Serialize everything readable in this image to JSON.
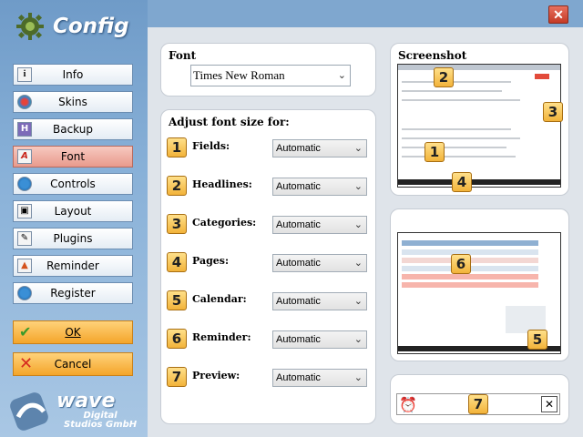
{
  "app": {
    "title": "Config"
  },
  "sidebar": {
    "items": [
      {
        "label": "Info",
        "icon": "info-icon",
        "active": false
      },
      {
        "label": "Skins",
        "icon": "skins-icon",
        "active": false
      },
      {
        "label": "Backup",
        "icon": "backup-icon",
        "active": false
      },
      {
        "label": "Font",
        "icon": "font-icon",
        "active": true
      },
      {
        "label": "Controls",
        "icon": "controls-icon",
        "active": false
      },
      {
        "label": "Layout",
        "icon": "layout-icon",
        "active": false
      },
      {
        "label": "Plugins",
        "icon": "plugins-icon",
        "active": false
      },
      {
        "label": "Reminder",
        "icon": "reminder-icon",
        "active": false
      },
      {
        "label": "Register",
        "icon": "register-icon",
        "active": false
      }
    ],
    "ok_label": "OK",
    "cancel_label": "Cancel"
  },
  "brand": {
    "name": "wave",
    "sub1": "Digital",
    "sub2": "Studios GmbH"
  },
  "font_panel": {
    "title": "Font",
    "selected": "Times New Roman"
  },
  "adjust_panel": {
    "title": "Adjust font size for:",
    "rows": [
      {
        "num": "1",
        "label": "Fields:",
        "value": "Automatic"
      },
      {
        "num": "2",
        "label": "Headlines:",
        "value": "Automatic"
      },
      {
        "num": "3",
        "label": "Categories:",
        "value": "Automatic"
      },
      {
        "num": "4",
        "label": "Pages:",
        "value": "Automatic"
      },
      {
        "num": "5",
        "label": "Calendar:",
        "value": "Automatic"
      },
      {
        "num": "6",
        "label": "Reminder:",
        "value": "Automatic"
      },
      {
        "num": "7",
        "label": "Preview:",
        "value": "Automatic"
      }
    ]
  },
  "screenshot_panel": {
    "title": "Screenshot"
  },
  "screenshot_badges": {
    "b1": "1",
    "b2": "2",
    "b3": "3",
    "b4": "4",
    "b5": "5",
    "b6": "6",
    "b7": "7"
  },
  "colors": {
    "accent": "#f4a52a",
    "active_nav": "#e89a8c",
    "sidebar": "#7fa7cf",
    "close": "#c43a26"
  }
}
